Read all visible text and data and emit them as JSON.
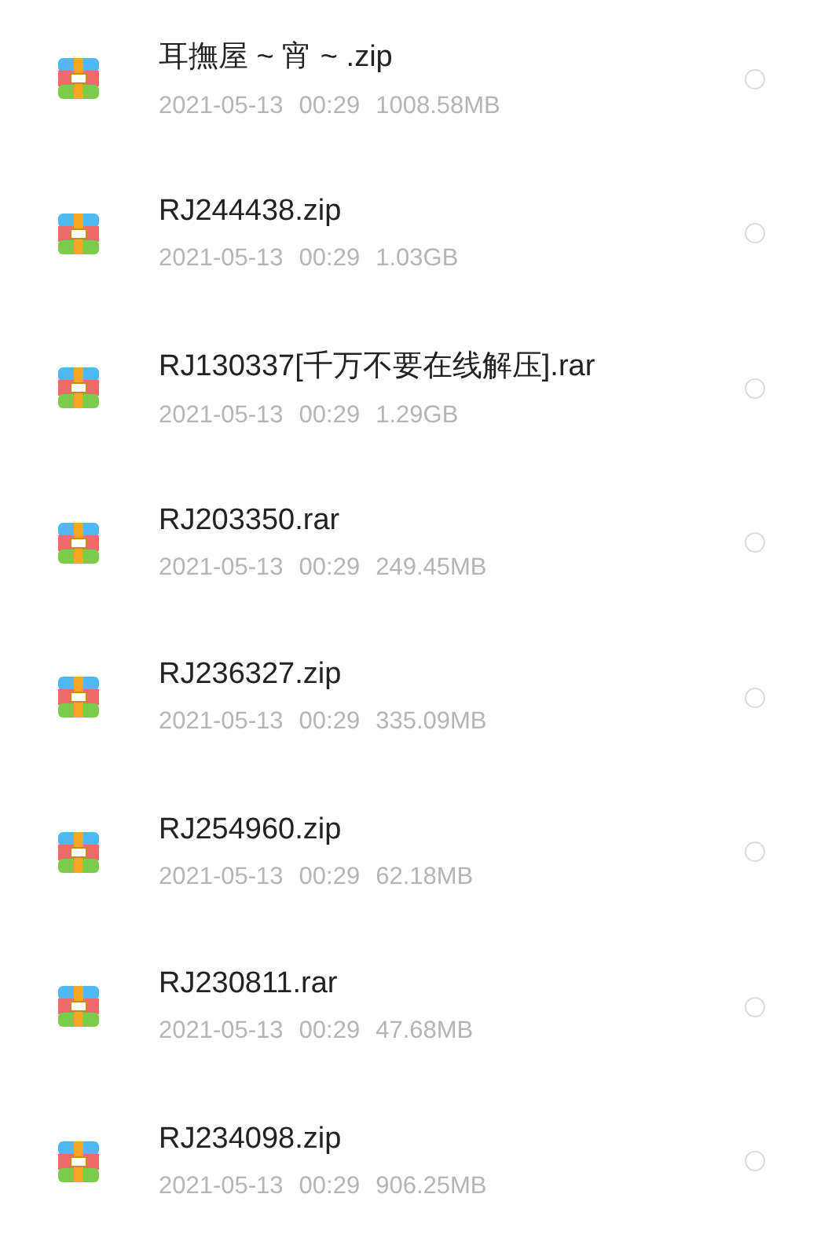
{
  "files": [
    {
      "name": "耳撫屋 ~ 宵 ~ .zip",
      "date": "2021-05-13",
      "time": "00:29",
      "size": "1008.58MB",
      "selected": false
    },
    {
      "name": "RJ244438.zip",
      "date": "2021-05-13",
      "time": "00:29",
      "size": "1.03GB",
      "selected": false
    },
    {
      "name": "RJ130337[千万不要在线解压].rar",
      "date": "2021-05-13",
      "time": "00:29",
      "size": "1.29GB",
      "selected": false
    },
    {
      "name": "RJ203350.rar",
      "date": "2021-05-13",
      "time": "00:29",
      "size": "249.45MB",
      "selected": false
    },
    {
      "name": "RJ236327.zip",
      "date": "2021-05-13",
      "time": "00:29",
      "size": "335.09MB",
      "selected": false
    },
    {
      "name": "RJ254960.zip",
      "date": "2021-05-13",
      "time": "00:29",
      "size": "62.18MB",
      "selected": false
    },
    {
      "name": "RJ230811.rar",
      "date": "2021-05-13",
      "time": "00:29",
      "size": "47.68MB",
      "selected": false
    },
    {
      "name": "RJ234098.zip",
      "date": "2021-05-13",
      "time": "00:29",
      "size": "906.25MB",
      "selected": false
    }
  ]
}
